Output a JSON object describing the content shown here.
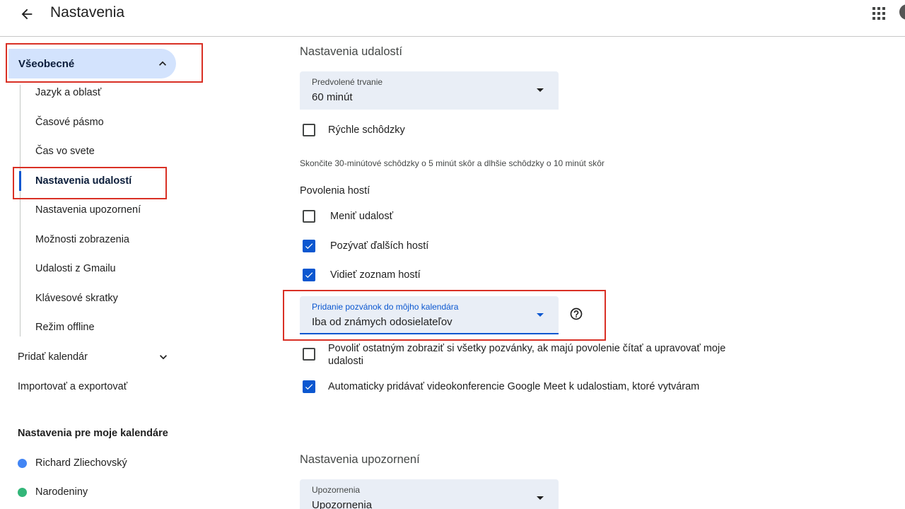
{
  "header": {
    "title": "Nastavenia",
    "back_icon": "arrow-back-icon",
    "apps_icon": "apps-grid-icon"
  },
  "sidebar": {
    "general_label": "Všeobecné",
    "sub_items": [
      "Jazyk a oblasť",
      "Časové pásmo",
      "Čas vo svete",
      "Nastavenia udalostí",
      "Nastavenia upozornení",
      "Možnosti zobrazenia",
      "Udalosti z Gmailu",
      "Klávesové skratky",
      "Režim offline"
    ],
    "active_sub_item": "Nastavenia udalostí",
    "add_calendar": "Pridať kalendár",
    "import_export": "Importovať a exportovať",
    "my_calendars_heading": "Nastavenia pre moje kalendáre",
    "calendars": [
      {
        "name": "Richard Zliechovský",
        "color": "#4285f4"
      },
      {
        "name": "Narodeniny",
        "color": "#33b679"
      }
    ]
  },
  "main": {
    "event_settings_title": "Nastavenia udalostí",
    "default_duration": {
      "label": "Predvolené trvanie",
      "value": "60 minút"
    },
    "speedy_meetings": {
      "label": "Rýchle schôdzky",
      "checked": false
    },
    "speedy_hint": "Skončite 30-minútové schôdzky o 5 minút skôr a dlhšie schôdzky o 10 minút skôr",
    "guest_permissions_title": "Povolenia hostí",
    "guest_permissions": [
      {
        "label": "Meniť udalosť",
        "checked": false
      },
      {
        "label": "Pozývať ďalších hostí",
        "checked": true
      },
      {
        "label": "Vidieť zoznam hostí",
        "checked": true
      }
    ],
    "invitations": {
      "label": "Pridanie pozvánok do môjho kalendára",
      "value": "Iba od známych odosielateľov"
    },
    "allow_others": {
      "label": "Povoliť ostatným zobraziť si všetky pozvánky, ak majú povolenie čítať a upravovať moje udalosti",
      "checked": false
    },
    "auto_meet": {
      "label": "Automaticky pridávať videokonferencie Google Meet k udalostiam, ktoré vytváram",
      "checked": true
    },
    "notification_settings_title": "Nastavenia upozornení",
    "notifications": {
      "label": "Upozornenia",
      "value": "Upozornenia"
    }
  },
  "colors": {
    "accent": "#0b57d0",
    "nav_active_bg": "#d3e3fd",
    "select_bg": "#e9eef6",
    "highlight_box": "#d93025"
  }
}
